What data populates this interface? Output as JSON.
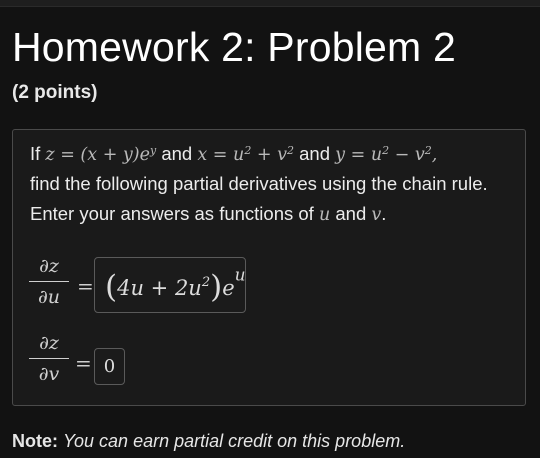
{
  "header": {
    "title": "Homework 2: Problem 2",
    "points": "(2 points)"
  },
  "problem": {
    "line1": {
      "t1": "If ",
      "eq_z": "z = (x + y)e",
      "eq_z_exp": "y",
      "t2": " and ",
      "eq_x": "x = u",
      "eq_x_exp1": "2",
      "eq_x_mid": " + v",
      "eq_x_exp2": "2",
      "t3": " and ",
      "eq_y": "y = u",
      "eq_y_exp1": "2",
      "eq_y_mid": " − v",
      "eq_y_exp2": "2",
      "eq_y_end": ","
    },
    "line2": "find the following partial derivatives using the chain rule.",
    "line3": {
      "t1": "Enter your answers as functions of ",
      "var_u": "u",
      "t2": " and ",
      "var_v": "v",
      "t3": "."
    }
  },
  "derivatives": [
    {
      "numerator": "∂z",
      "denominator": "∂u",
      "equals": "=",
      "answer": {
        "open": "(",
        "a": "4u + 2u",
        "exp": "2",
        "close": ")",
        "e": "e",
        "e_exp": "u"
      }
    },
    {
      "numerator": "∂z",
      "denominator": "∂v",
      "equals": "=",
      "answer_value": "0"
    }
  ],
  "note": {
    "label": "Note:",
    "text": "You can earn partial credit on this problem."
  }
}
